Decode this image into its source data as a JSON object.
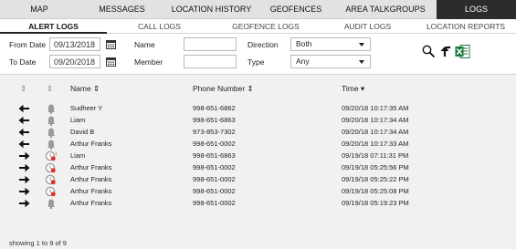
{
  "main_tabs": [
    {
      "label": "MAP",
      "active": false
    },
    {
      "label": "MESSAGES",
      "active": false
    },
    {
      "label": "LOCATION HISTORY",
      "active": false
    },
    {
      "label": "GEOFENCES",
      "active": false
    },
    {
      "label": "AREA TALKGROUPS",
      "active": false
    },
    {
      "label": "LOGS",
      "active": true
    }
  ],
  "sub_tabs": [
    {
      "label": "ALERT LOGS",
      "active": true
    },
    {
      "label": "CALL LOGS",
      "active": false
    },
    {
      "label": "GEOFENCE LOGS",
      "active": false
    },
    {
      "label": "AUDIT LOGS",
      "active": false
    },
    {
      "label": "LOCATION REPORTS",
      "active": false
    }
  ],
  "filters": {
    "from_date_label": "From Date",
    "from_date_value": "09/13/2018",
    "to_date_label": "To Date",
    "to_date_value": "09/20/2018",
    "name_label": "Name",
    "name_value": "",
    "member_label": "Member",
    "member_value": "",
    "direction_label": "Direction",
    "direction_value": "Both",
    "type_label": "Type",
    "type_value": "Any"
  },
  "toolbar": {
    "search_icon": "search-icon",
    "reset_icon": "undo-arrow-icon",
    "excel_icon": "excel-export-icon",
    "excel_color": "#1d7a3d"
  },
  "table": {
    "headers": {
      "direction": "⇕",
      "type": "⇕",
      "name": "Name ⇕",
      "phone": "Phone Number ⇕",
      "time": "Time ▾"
    },
    "rows": [
      {
        "direction": "incoming",
        "icon": "bell-icon",
        "name": "Sudheer Y",
        "phone": "998-651-6862",
        "time": "09/20/18 10:17:35 AM"
      },
      {
        "direction": "incoming",
        "icon": "bell-icon",
        "name": "Liam",
        "phone": "998-651-6863",
        "time": "09/20/18 10:17:34 AM"
      },
      {
        "direction": "incoming",
        "icon": "bell-icon",
        "name": "David B",
        "phone": "973-853-7302",
        "time": "09/20/18 10:17:34 AM"
      },
      {
        "direction": "incoming",
        "icon": "bell-icon",
        "name": "Arthur Franks",
        "phone": "998-651-0002",
        "time": "09/20/18 10:17:33 AM"
      },
      {
        "direction": "outgoing",
        "icon": "bell-alert-badge-icon",
        "badge": "1",
        "name": "Liam",
        "phone": "998-651-6863",
        "time": "09/19/18 07:11:31 PM"
      },
      {
        "direction": "outgoing",
        "icon": "bell-alert-icon",
        "name": "Arthur Franks",
        "phone": "998-651-0002",
        "time": "09/19/18 05:25:56 PM"
      },
      {
        "direction": "outgoing",
        "icon": "bell-alert-icon",
        "name": "Arthur Franks",
        "phone": "998-651-0002",
        "time": "09/19/18 05:25:22 PM"
      },
      {
        "direction": "outgoing",
        "icon": "bell-alert-icon",
        "name": "Arthur Franks",
        "phone": "998-651-0002",
        "time": "09/19/18 05:25:08 PM"
      },
      {
        "direction": "outgoing",
        "icon": "bell-icon",
        "name": "Arthur Franks",
        "phone": "998-651-0002",
        "time": "09/19/18 05:19:23 PM"
      }
    ],
    "footer": "showing 1 to 9 of 9"
  },
  "colors": {
    "active_tab_bg": "#2c2c2c",
    "alert_red": "#e12a2a",
    "bell_gray": "#9a9a9a"
  }
}
